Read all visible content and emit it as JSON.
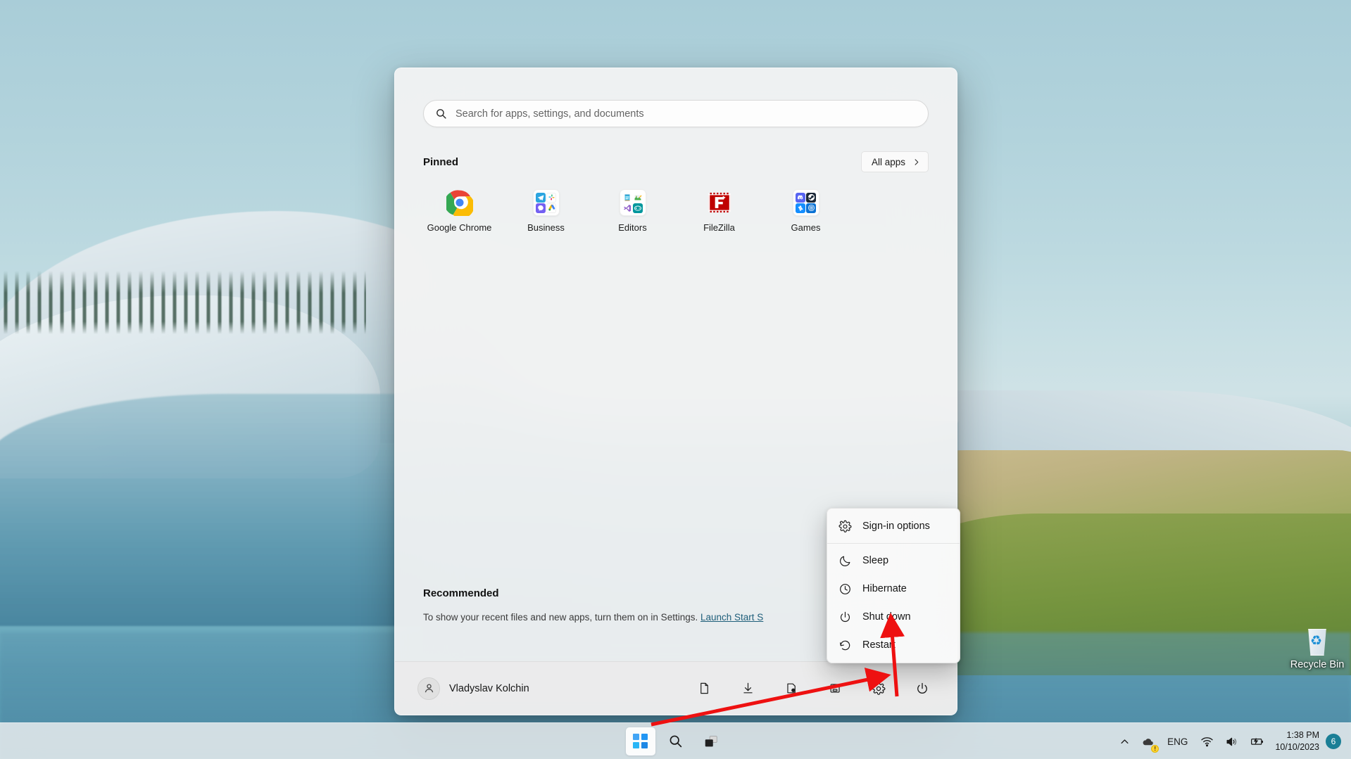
{
  "desktop": {
    "icons": [
      {
        "name": "Recycle Bin",
        "icon": "recycle-bin-icon"
      }
    ]
  },
  "start_menu": {
    "search": {
      "placeholder": "Search for apps, settings, and documents",
      "value": "",
      "icon": "search-icon"
    },
    "pinned": {
      "title": "Pinned",
      "all_apps_label": "All apps",
      "all_apps_icon": "chevron-right-icon",
      "items": [
        {
          "label": "Google Chrome",
          "icon": "google-chrome-icon",
          "type": "app"
        },
        {
          "label": "Business",
          "icon": "folder-icon",
          "type": "folder",
          "children": [
            "Telegram",
            "Slack",
            "Viber",
            "Google Ads"
          ]
        },
        {
          "label": "Editors",
          "icon": "folder-icon",
          "type": "folder",
          "children": [
            "Notepad",
            "Paint",
            "Visual Studio",
            "Arduino"
          ]
        },
        {
          "label": "FileZilla",
          "icon": "filezilla-icon",
          "type": "app"
        },
        {
          "label": "Games",
          "icon": "folder-icon",
          "type": "folder",
          "children": [
            "Discord",
            "Steam",
            "Battle.net",
            "Ubisoft Connect"
          ]
        }
      ]
    },
    "recommended": {
      "title": "Recommended",
      "empty_text": "To show your recent files and new apps, turn them on in Settings.",
      "link_text": "Launch Start S"
    },
    "footer": {
      "user_name": "Vladyslav Kolchin",
      "avatar_icon": "user-avatar-icon",
      "quick_icons": [
        {
          "name": "documents-icon"
        },
        {
          "name": "downloads-icon"
        },
        {
          "name": "pictures-icon"
        },
        {
          "name": "network-icon"
        },
        {
          "name": "settings-gear-icon"
        },
        {
          "name": "power-icon"
        }
      ]
    }
  },
  "power_menu": {
    "items": [
      {
        "label": "Sign-in options",
        "icon": "gear-icon"
      },
      {
        "label": "Sleep",
        "icon": "moon-icon"
      },
      {
        "label": "Hibernate",
        "icon": "clock-icon"
      },
      {
        "label": "Shut down",
        "icon": "power-icon"
      },
      {
        "label": "Restart",
        "icon": "restart-icon"
      }
    ]
  },
  "taskbar": {
    "buttons": [
      {
        "name": "start-button",
        "icon": "windows-logo-icon",
        "active": true
      },
      {
        "name": "search-button",
        "icon": "search-icon",
        "active": false
      },
      {
        "name": "task-view-button",
        "icon": "task-view-icon",
        "active": false
      }
    ],
    "tray": {
      "overflow_icon": "chevron-up-icon",
      "onedrive_icon": "onedrive-icon",
      "onedrive_badge": "!",
      "language": "ENG",
      "wifi_icon": "wifi-icon",
      "volume_icon": "volume-icon",
      "battery_icon": "battery-charging-icon",
      "time": "1:38 PM",
      "date": "10/10/2023",
      "notification_count": "6"
    }
  },
  "colors": {
    "accent": "#0078d4",
    "annotation": "#ee1111",
    "menu_bg": "#f9f9f9",
    "start_bg": "#f3f3f3",
    "badge": "#1b7f96"
  }
}
